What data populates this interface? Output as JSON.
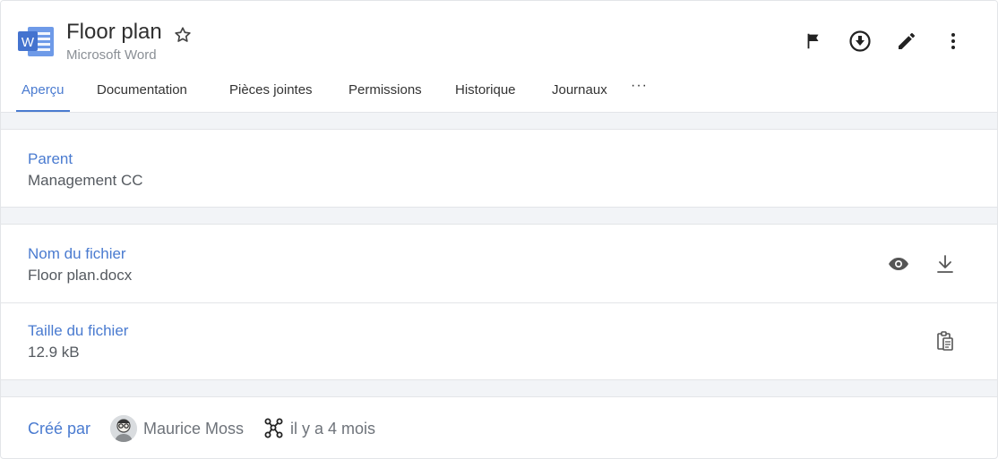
{
  "header": {
    "title": "Floor plan",
    "subtitle": "Microsoft Word",
    "app_icon": "word-icon",
    "app_icon_letter": "W",
    "actions": [
      "flag-icon",
      "download-circle-icon",
      "edit-icon",
      "more-vertical-icon"
    ]
  },
  "tabs": {
    "items": [
      "Aperçu",
      "Documentation",
      "Pièces jointes",
      "Permissions",
      "Historique",
      "Journaux"
    ],
    "more": "···",
    "active": "Aperçu"
  },
  "parent": {
    "label": "Parent",
    "value": "Management CC"
  },
  "file_name": {
    "label": "Nom du fichier",
    "value": "Floor plan.docx"
  },
  "file_size": {
    "label": "Taille du fichier",
    "value": "12.9 kB"
  },
  "created": {
    "label": "Créé par",
    "author": "Maurice Moss",
    "time": "il y a 4 mois"
  },
  "colors": {
    "accent": "#4a7bd0",
    "separator": "#f2f4f7",
    "word_blue": "#4f81d9"
  }
}
